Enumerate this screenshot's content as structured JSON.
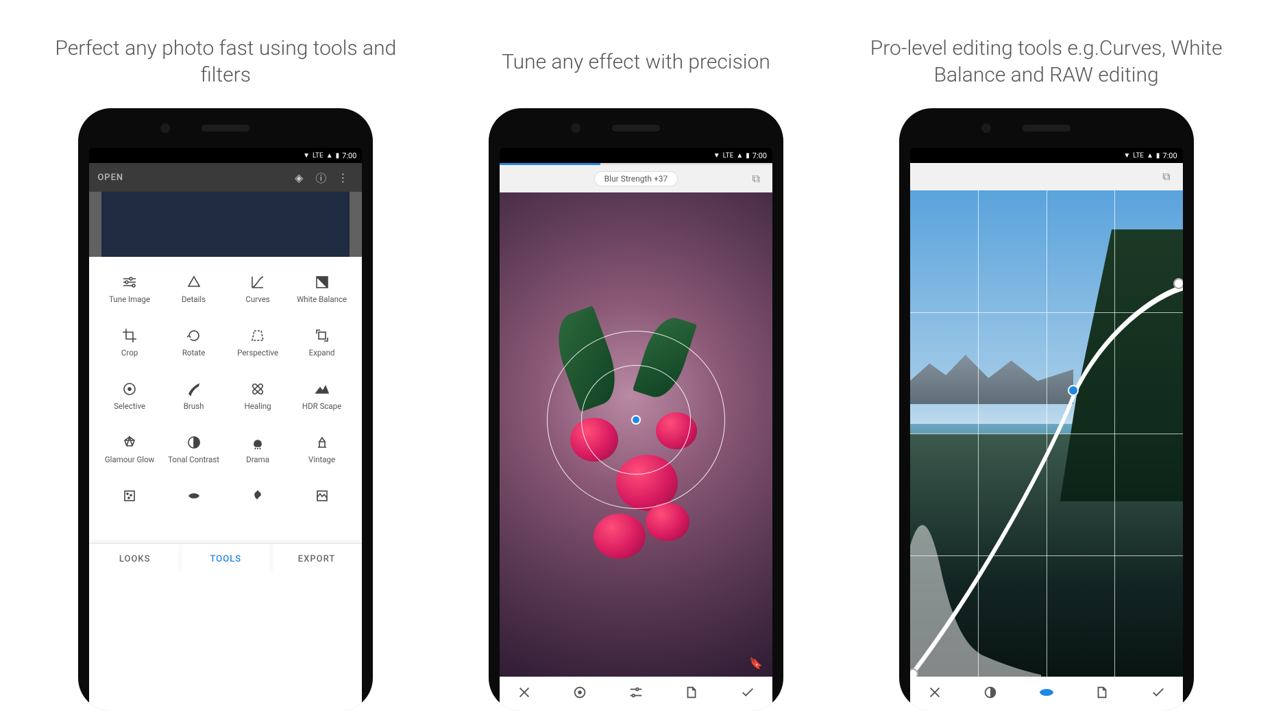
{
  "captions": {
    "p1": "Perfect any photo fast using tools and filters",
    "p2": "Tune any effect with precision",
    "p3": "Pro-level editing tools e.g.Curves, White Balance and RAW editing"
  },
  "status": {
    "wifi": "▾",
    "lte": "LTE",
    "signal": "▲",
    "battery": "▮",
    "time": "7:00"
  },
  "phone1": {
    "topbar": {
      "title": "OPEN"
    },
    "tools": [
      {
        "id": "tune-image",
        "label": "Tune Image"
      },
      {
        "id": "details",
        "label": "Details"
      },
      {
        "id": "curves",
        "label": "Curves"
      },
      {
        "id": "white-balance",
        "label": "White Balance"
      },
      {
        "id": "crop",
        "label": "Crop"
      },
      {
        "id": "rotate",
        "label": "Rotate"
      },
      {
        "id": "perspective",
        "label": "Perspective"
      },
      {
        "id": "expand",
        "label": "Expand"
      },
      {
        "id": "selective",
        "label": "Selective"
      },
      {
        "id": "brush",
        "label": "Brush"
      },
      {
        "id": "healing",
        "label": "Healing"
      },
      {
        "id": "hdr-scape",
        "label": "HDR Scape"
      },
      {
        "id": "glamour-glow",
        "label": "Glamour Glow"
      },
      {
        "id": "tonal-contrast",
        "label": "Tonal Contrast"
      },
      {
        "id": "drama",
        "label": "Drama"
      },
      {
        "id": "vintage",
        "label": "Vintage"
      },
      {
        "id": "grainy-film",
        "label": ""
      },
      {
        "id": "retrolux",
        "label": ""
      },
      {
        "id": "grunge",
        "label": ""
      },
      {
        "id": "pop",
        "label": ""
      }
    ],
    "tabs": {
      "looks": "LOOKS",
      "tools": "TOOLS",
      "export": "EXPORT"
    }
  },
  "phone2": {
    "chip": "Blur Strength +37",
    "progress_pct": 37
  },
  "colors": {
    "accent": "#1e88e5"
  }
}
